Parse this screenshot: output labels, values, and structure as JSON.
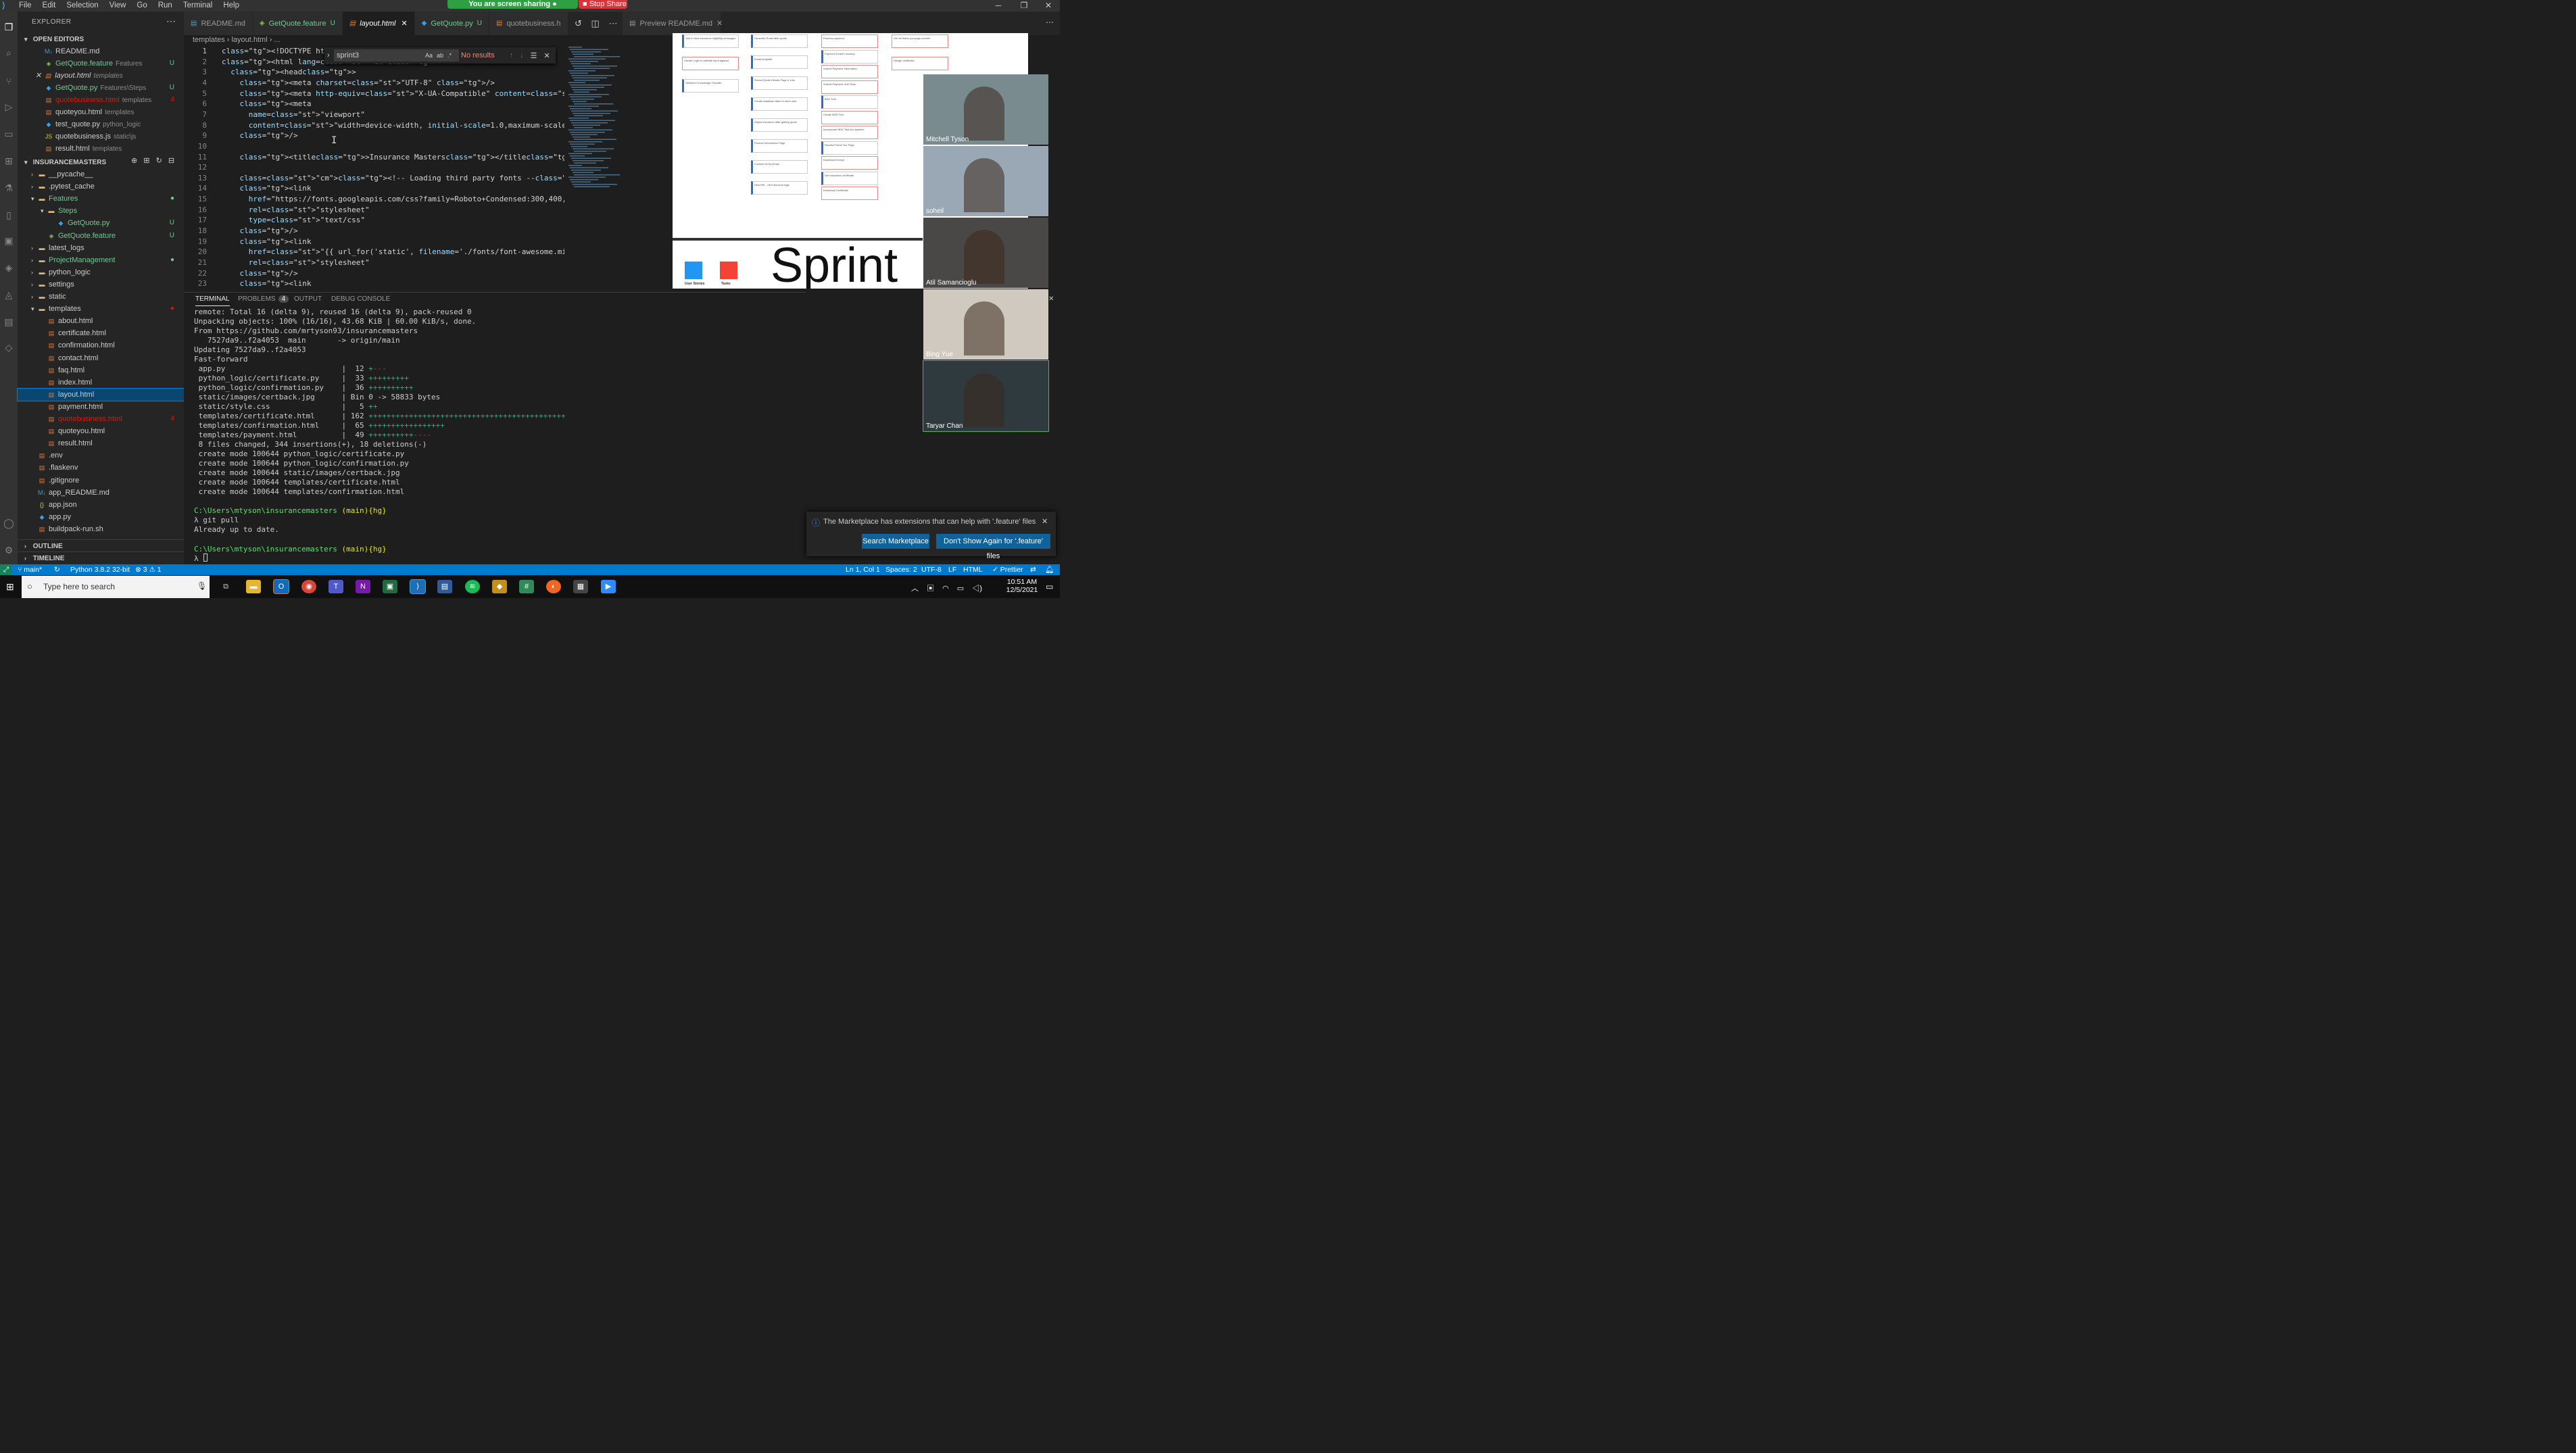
{
  "menu": [
    "File",
    "Edit",
    "Selection",
    "View",
    "Go",
    "Run",
    "Terminal",
    "Help"
  ],
  "sharing": {
    "text": "You are screen sharing",
    "stop": "Stop Share"
  },
  "explorer": {
    "title": "EXPLORER",
    "open_editors_title": "OPEN EDITORS",
    "open_editors": [
      {
        "name": "README.md",
        "sub": "",
        "badge": "",
        "icon": "md"
      },
      {
        "name": "GetQuote.feature",
        "sub": "Features",
        "badge": "U",
        "icon": "feat"
      },
      {
        "name": "layout.html",
        "sub": "templates",
        "badge": "",
        "icon": "html"
      },
      {
        "name": "GetQuote.py",
        "sub": "Features\\Steps",
        "badge": "U",
        "icon": "py"
      },
      {
        "name": "quotebusiness.html",
        "sub": "templates",
        "badge": "4",
        "icon": "html"
      },
      {
        "name": "quoteyou.html",
        "sub": "templates",
        "badge": "",
        "icon": "html"
      },
      {
        "name": "test_quote.py",
        "sub": "python_logic",
        "badge": "",
        "icon": "py"
      },
      {
        "name": "quotebusiness.js",
        "sub": "static\\js",
        "badge": "",
        "icon": "js"
      },
      {
        "name": "result.html",
        "sub": "templates",
        "badge": "",
        "icon": "html"
      }
    ],
    "project_title": "INSURANCEMASTERS",
    "tree": [
      {
        "name": "__pycache__",
        "indent": 1,
        "folder": true,
        "open": false
      },
      {
        "name": ".pytest_cache",
        "indent": 1,
        "folder": true,
        "open": false
      },
      {
        "name": "Features",
        "indent": 1,
        "folder": true,
        "open": true
      },
      {
        "name": "Steps",
        "indent": 2,
        "folder": true,
        "open": true
      },
      {
        "name": "GetQuote.py",
        "indent": 3,
        "folder": false,
        "badge": "U"
      },
      {
        "name": "GetQuote.feature",
        "indent": 2,
        "folder": false,
        "badge": "U"
      },
      {
        "name": "latest_logs",
        "indent": 1,
        "folder": true,
        "open": false
      },
      {
        "name": "ProjectManagement",
        "indent": 1,
        "folder": true,
        "open": false
      },
      {
        "name": "python_logic",
        "indent": 1,
        "folder": true,
        "open": false
      },
      {
        "name": "settings",
        "indent": 1,
        "folder": true,
        "open": false
      },
      {
        "name": "static",
        "indent": 1,
        "folder": true,
        "open": false
      },
      {
        "name": "templates",
        "indent": 1,
        "folder": true,
        "open": true
      },
      {
        "name": "about.html",
        "indent": 2,
        "folder": false
      },
      {
        "name": "certificate.html",
        "indent": 2,
        "folder": false
      },
      {
        "name": "confirmation.html",
        "indent": 2,
        "folder": false
      },
      {
        "name": "contact.html",
        "indent": 2,
        "folder": false
      },
      {
        "name": "faq.html",
        "indent": 2,
        "folder": false
      },
      {
        "name": "index.html",
        "indent": 2,
        "folder": false
      },
      {
        "name": "layout.html",
        "indent": 2,
        "folder": false
      },
      {
        "name": "payment.html",
        "indent": 2,
        "folder": false
      },
      {
        "name": "quotebusiness.html",
        "indent": 2,
        "folder": false,
        "badge": "4"
      },
      {
        "name": "quoteyou.html",
        "indent": 2,
        "folder": false
      },
      {
        "name": "result.html",
        "indent": 2,
        "folder": false
      },
      {
        "name": ".env",
        "indent": 1,
        "folder": false
      },
      {
        "name": ".flaskenv",
        "indent": 1,
        "folder": false
      },
      {
        "name": ".gitignore",
        "indent": 1,
        "folder": false
      },
      {
        "name": "app_README.md",
        "indent": 1,
        "folder": false
      },
      {
        "name": "app.json",
        "indent": 1,
        "folder": false
      },
      {
        "name": "app.py",
        "indent": 1,
        "folder": false
      },
      {
        "name": "buildpack-run.sh",
        "indent": 1,
        "folder": false
      }
    ],
    "outline": "OUTLINE",
    "timeline": "TIMELINE"
  },
  "tabs": [
    {
      "label": "README.md",
      "u": ""
    },
    {
      "label": "GetQuote.feature",
      "u": "U"
    },
    {
      "label": "layout.html",
      "u": ""
    },
    {
      "label": "GetQuote.py",
      "u": "U"
    },
    {
      "label": "quotebusiness.h",
      "u": ""
    }
  ],
  "preview_tab": "Preview README.md",
  "breadcrumb": "templates  ›  layout.html  ›  ...",
  "find": {
    "value": "sprint3",
    "result": "No results"
  },
  "code": [
    "<!DOCTYPE html>",
    "<html lang=\"en\">",
    "  <head>",
    "    <meta charset=\"UTF-8\" />",
    "    <meta http-equiv=\"X-UA-Compatible\" content=\"IE=edge\" />",
    "    <meta",
    "      name=\"viewport\"",
    "      content=\"width=device-width, initial-scale=1.0,maximum-scale=1\"",
    "    />",
    "",
    "    <title>Insurance Masters</title>",
    "",
    "    <!-- Loading third party fonts -->",
    "    <link",
    "      href=\"https://fonts.googleapis.com/css?family=Roboto+Condensed:300,400,700",
    "      rel=\"stylesheet\"",
    "      type=\"text/css\"",
    "    />",
    "    <link",
    "      href=\"{{ url_for('static', filename='./fonts/font-awesome.min.css') }}\"",
    "      rel=\"stylesheet\"",
    "    />",
    "    <link"
  ],
  "preview_banner": "Sprint",
  "preview_legend": [
    "User Stories",
    "Tasks"
  ],
  "board": [
    [
      "Just in time insurance eligibility messages",
      "Create Logic to validate input against",
      "Selenium Knowledge Transfer"
    ],
    [
      "Generate Email after quote",
      "Email template",
      "Revisit Quote Details Page & Link",
      "Create database table to store user",
      "Adjust insurance after getting quote",
      "Product Information Page",
      "Contact Us By Email",
      "New FBI - 15% discount logic"
    ],
    [
      "Process payment",
      "Payment Screen mockup",
      "Submit Payment Information",
      "Submit Payment Unit Tests",
      "BDD Test",
      "Create BDD Test",
      "Incorporate BDD Test into pipeline",
      "Results/Thank You Page",
      "Download receipt",
      "Get insurance certificate",
      "Download Certificate"
    ],
    [
      "Get all thank you page content",
      "Design certificate"
    ]
  ],
  "participants": [
    "Mitchell Tyson",
    "soheil",
    "Atil Samancioglu",
    "Bing Yue",
    "Taryar Chan"
  ],
  "panel_tabs": [
    "TERMINAL",
    "PROBLEMS",
    "OUTPUT",
    "DEBUG CONSOLE"
  ],
  "problems_count": "4",
  "terminal": [
    "remote: Total 16 (delta 9), reused 16 (delta 9), pack-reused 0",
    "Unpacking objects: 100% (16/16), 43.68 KiB | 60.00 KiB/s, done.",
    "From https://github.com/mrtyson93/insurancemasters",
    "   7527da9..f2a4053  main       -> origin/main",
    "Updating 7527da9..f2a4053",
    "Fast-forward",
    " app.py                          |  12 +---",
    " python_logic/certificate.py     |  33 +++++++++",
    " python_logic/confirmation.py    |  36 ++++++++++",
    " static/images/certback.jpg      | Bin 0 -> 58833 bytes",
    " static/style.css                |   5 ++",
    " templates/certificate.html      | 162 ++++++++++++++++++++++++++++++++++++++++++++",
    " templates/confirmation.html     |  65 +++++++++++++++++",
    " templates/payment.html          |  49 ++++++++++----",
    " 8 files changed, 344 insertions(+), 18 deletions(-)",
    " create mode 100644 python_logic/certificate.py",
    " create mode 100644 python_logic/confirmation.py",
    " create mode 100644 static/images/certback.jpg",
    " create mode 100644 templates/certificate.html",
    " create mode 100644 templates/confirmation.html",
    "",
    "C:\\Users\\mtyson\\insurancemasters (main){hg}",
    "λ git pull",
    "Already up to date.",
    "",
    "C:\\Users\\mtyson\\insurancemasters (main){hg}",
    "λ "
  ],
  "notification": {
    "text": "The Marketplace has extensions that can help with '.feature' files",
    "btn1": "Search Marketplace",
    "btn2": "Don't Show Again for '.feature' files"
  },
  "status": {
    "branch": "main*",
    "python": "Python 3.8.2 32-bit",
    "errors": "⊗ 3 ⚠ 1",
    "pos": "Ln 1, Col 1",
    "spaces": "Spaces: 2",
    "enc": "UTF-8",
    "eol": "LF",
    "lang": "HTML",
    "prettier": "✓ Prettier"
  },
  "taskbar": {
    "search": "Type here to search",
    "time": "10:51 AM",
    "date": "12/5/2021"
  },
  "colors": {
    "accent": "#007acc",
    "share": "#2ea043",
    "stop": "#d9343b"
  }
}
